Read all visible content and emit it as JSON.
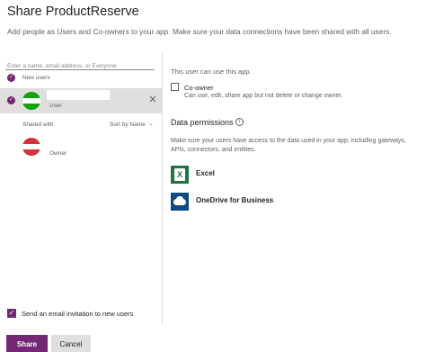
{
  "header": {
    "title": "Share ProductReserve",
    "subtitle": "Add people as Users and Co-owners to your app. Make sure your data connections have been shared with all users."
  },
  "left_panel": {
    "search": {
      "placeholder": "Enter a name, email address, or Everyone",
      "value": ""
    },
    "new_users_label": "New users",
    "new_user": {
      "role": "User",
      "remove_icon": "close-icon"
    },
    "shared_with_label": "Shared with",
    "sort_label": "Sort by Name",
    "owner": {
      "role": "Owner"
    },
    "email_invite": {
      "label": "Send an email invitation to new users",
      "checked": true
    }
  },
  "right_panel": {
    "user_can_use": "This user can use this app.",
    "coowner_label": "Co-owner",
    "coowner_desc": "Can use, edit, share app but not delete or change owner.",
    "data_permissions_title": "Data permissions",
    "data_permissions_desc": "Make sure your users have access to the data used in your app, including gateways, APIs, connectors, and entities.",
    "connections": [
      {
        "label": "Excel",
        "icon": "excel-icon"
      },
      {
        "label": "OneDrive for Business",
        "icon": "onedrive-icon"
      }
    ]
  },
  "footer": {
    "share_label": "Share",
    "cancel_label": "Cancel"
  },
  "colors": {
    "accent": "#742774",
    "avatar_user": "#13a10e",
    "avatar_owner": "#d13438",
    "excel": "#217346",
    "onedrive": "#0f4c81"
  }
}
